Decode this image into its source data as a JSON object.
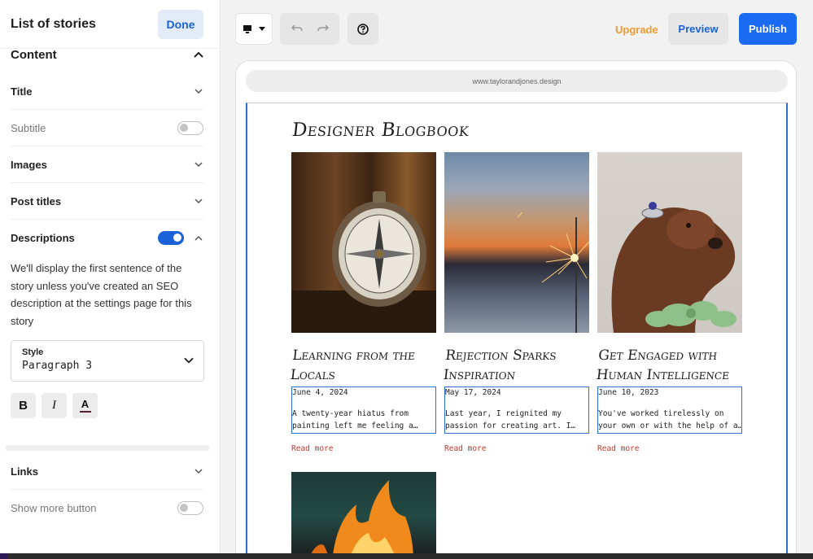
{
  "sidebar": {
    "title": "List of stories",
    "done_label": "Done",
    "content_label": "Content",
    "rows": {
      "title": "Title",
      "subtitle": "Subtitle",
      "images": "Images",
      "post_titles": "Post titles",
      "descriptions": "Descriptions"
    },
    "toggles": {
      "subtitle": false,
      "descriptions": true,
      "show_more": false
    },
    "descriptions_help": "We'll display the first sentence of the story unless you've created an SEO description at the settings page for this story",
    "style": {
      "label": "Style",
      "value": "Paragraph 3"
    },
    "format": {
      "bold": "B",
      "italic": "I",
      "color": "A"
    },
    "links_label": "Links",
    "show_more_label": "Show more button"
  },
  "toolbar": {
    "upgrade_label": "Upgrade",
    "preview_label": "Preview",
    "publish_label": "Publish"
  },
  "canvas": {
    "url": "www.taylorandjones.design",
    "blog_title": "Designer Blogbook",
    "posts": [
      {
        "title_line1": "Learning from the",
        "title_line2": "Locals",
        "date": "June 4, 2024",
        "excerpt1": "A twenty-year hiatus from",
        "excerpt2": "painting left me feeling a…",
        "read_more": "Read more",
        "image": "compass-photo"
      },
      {
        "title_line1": "Rejection Sparks",
        "title_line2": "Inspiration",
        "date": "May 17, 2024",
        "excerpt1": "Last year, I reignited my",
        "excerpt2": "passion for creating art. I…",
        "read_more": "Read more",
        "image": "sparkler-sunset-photo"
      },
      {
        "title_line1": "Get Engaged with",
        "title_line2": "Human Intelligence",
        "date": "June 10, 2023",
        "excerpt1": "You've worked tirelessly on",
        "excerpt2": "your own or with the help of a…",
        "read_more": "Read more",
        "image": "puppy-ring-photo"
      },
      {
        "image": "fire-photo"
      }
    ]
  },
  "colors": {
    "accent": "#1b62d8",
    "publish": "#1b6bf2",
    "upgrade": "#f29a2e",
    "read_more": "#c0392b",
    "selection": "#2c6ed1"
  }
}
